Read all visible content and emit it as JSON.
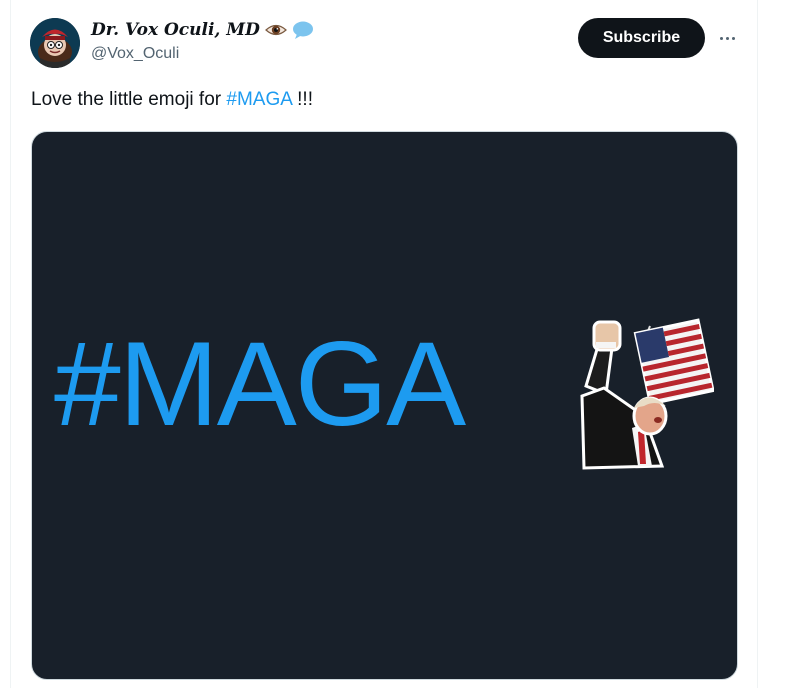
{
  "author": {
    "display_name": "Dr. Vox Oculi, MD",
    "handle": "@Vox_Oculi",
    "name_emojis": [
      "eye-icon",
      "speech-bubble-icon"
    ]
  },
  "actions": {
    "subscribe_label": "Subscribe",
    "more_icon": "more-horizontal-icon"
  },
  "tweet": {
    "text_before": "Love the little emoji for ",
    "hashtag": "#MAGA",
    "text_after": " !!!"
  },
  "media": {
    "text": "#MAGA",
    "emoji_icon": "fist-pump-flag-emoji"
  },
  "colors": {
    "accent": "#1d9bf0",
    "text": "#0f1419",
    "secondary_text": "#536471",
    "button_bg": "#0f1419",
    "media_bg": "#18202a"
  }
}
